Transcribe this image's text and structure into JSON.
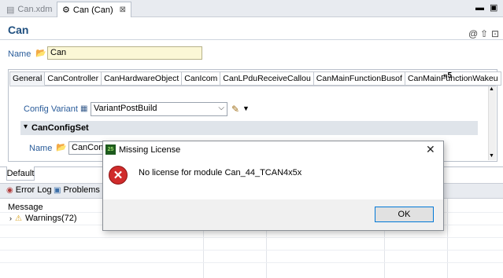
{
  "editor_tabs": [
    {
      "label": "Can.xdm",
      "active": false
    },
    {
      "label": "Can (Can)",
      "active": true
    }
  ],
  "tab_close_glyph": "⊠",
  "editor": {
    "title": "Can",
    "name_label": "Name",
    "name_value": "Can"
  },
  "subtabs": [
    "General",
    "CanController",
    "CanHardwareObject",
    "CanIcom",
    "CanLPduReceiveCallou",
    "CanMainFunctionBusof",
    "CanMainFunctionWakeu"
  ],
  "subtab_overflow": "»5",
  "general": {
    "config_variant_label": "Config Variant",
    "config_variant_value": "VariantPostBuild",
    "section_title": "CanConfigSet",
    "config_name_label": "Name",
    "config_name_value": "CanConfi"
  },
  "page_tabs": [
    "Default"
  ],
  "views": {
    "tabs": [
      "Error Log",
      "Problems Vi"
    ],
    "message_header": "Message",
    "warnings_row": "Warnings(72)"
  },
  "dialog": {
    "title": "Missing License",
    "message": "No license for module Can_44_TCAN4x5x",
    "ok_label": "OK",
    "app_icon_text": "25"
  },
  "colors": {
    "title_blue": "#1f4f7f",
    "error_red": "#d02b2b",
    "name_field_bg": "#fbf7d6"
  },
  "icons": [
    "folder-icon",
    "pencil-icon",
    "error-icon",
    "warning-icon",
    "module-icon"
  ]
}
